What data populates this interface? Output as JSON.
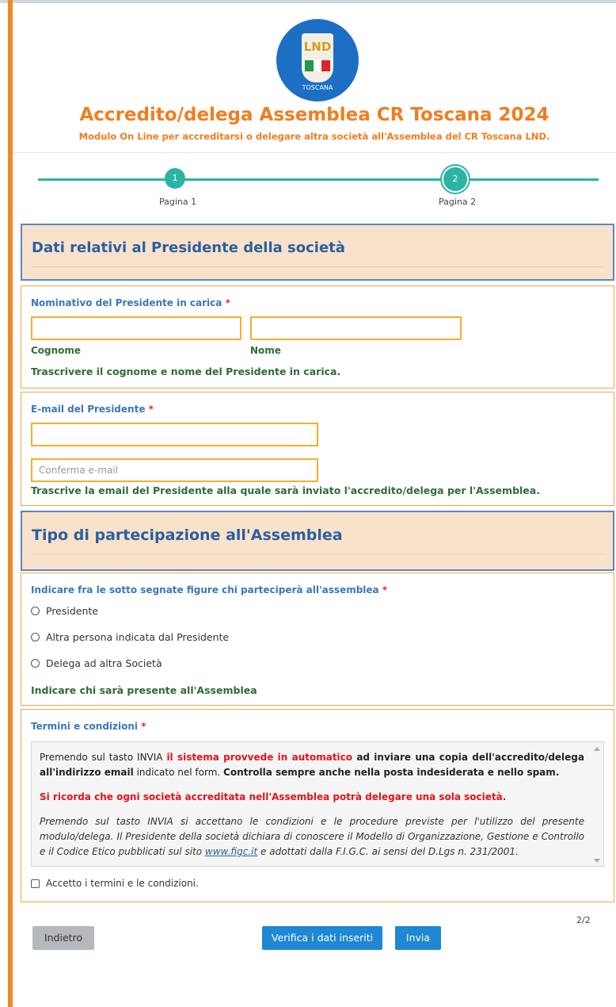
{
  "header": {
    "title": "Accredito/delega Assemblea CR Toscana 2024",
    "subtitle": "Modulo On Line per accreditarsi o delegare altra società all'Assemblea del CR Toscana LND.",
    "logo": {
      "text": "LND",
      "caption": "TOSCANA"
    }
  },
  "progress": {
    "steps": [
      {
        "number": "1",
        "label": "Pagina 1"
      },
      {
        "number": "2",
        "label": "Pagina 2"
      }
    ],
    "current": 2
  },
  "section_president": {
    "heading": "Dati relativi al Presidente della società",
    "name_question": {
      "label": "Nominativo del Presidente in carica",
      "required_mark": "*",
      "surname_value": "",
      "name_value": "",
      "surname_label": "Cognome",
      "name_label": "Nome",
      "help": "Trascrivere il cognome e nome del Presidente in carica."
    },
    "email_question": {
      "label": "E-mail del Presidente",
      "required_mark": "*",
      "email_value": "",
      "confirm_placeholder": "Conferma e-mail",
      "help": "Trascrive la email del Presidente alla quale sarà inviato l'accredito/delega per l'Assemblea."
    }
  },
  "section_participation": {
    "heading": "Tipo di partecipazione all'Assemblea",
    "question": {
      "label": "Indicare fra le sotto segnate figure chi parteciperà all'assemblea",
      "required_mark": "*",
      "options": [
        "Presidente",
        "Altra persona indicata dal Presidente",
        "Delega ad altra Società"
      ],
      "help": "Indicare chi sarà presente all'Assemblea"
    }
  },
  "terms": {
    "label": "Termini e condizioni",
    "required_mark": "*",
    "p1_a": "Premendo sul tasto INVIA ",
    "p1_b": "il sistema provvede in automatico",
    "p1_c": " ad inviare una copia dell'accredito/delega all'indirizzo email",
    "p1_d": " indicato nel form. ",
    "p1_e": "Controlla sempre anche nella posta indesiderata e nello spam.",
    "p2": "Si ricorda che ogni società accreditata nell'Assemblea potrà delegare una sola società.",
    "p3_a": "Premendo sul tasto INVIA si accettano le condizioni e le procedure previste per l'utilizzo del presente modulo/delega. Il Presidente della società dichiara di conoscere il Modello di Organizzazione, Gestione e Controllo e il Codice Etico pubblicati sul sito ",
    "p3_link": "www.figc.it",
    "p3_b": " e adottati dalla F.I.G.C. ai sensi del D.Lgs n. 231/2001.",
    "checkbox_label": "Accetto i termini e le condizioni."
  },
  "buttons": {
    "back": "Indietro",
    "verify": "Verifica i dati inseriti",
    "submit": "Invia"
  },
  "page_counter": "2/2",
  "colors": {
    "accent_orange": "#f07d1f",
    "progress_teal": "#2bb3a3",
    "section_blue": "#2b5f9e",
    "button_blue": "#1f87d3",
    "error_red": "#e0141b"
  }
}
